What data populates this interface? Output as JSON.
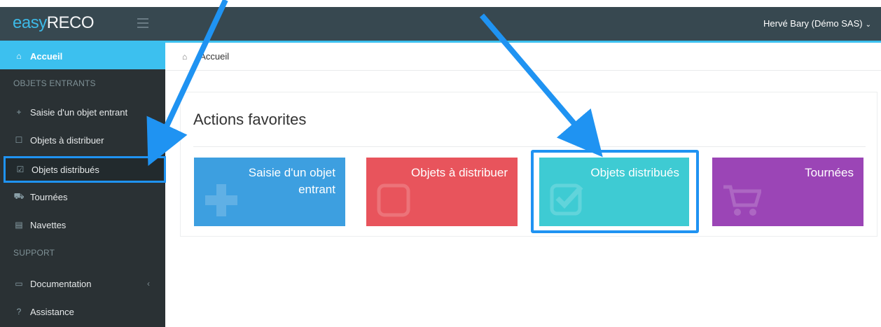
{
  "header": {
    "logo_prefix": "easy",
    "logo_suffix": "RECO",
    "user_name": "Hervé Bary (Démo SAS)",
    "user_chevron": "⌄"
  },
  "sidebar": {
    "items": [
      {
        "label": "Accueil",
        "icon": "home-icon",
        "glyph": "⌂"
      },
      {
        "label": "Saisie d'un objet entrant",
        "icon": "plus-icon",
        "glyph": "+"
      },
      {
        "label": "Objets à distribuer",
        "icon": "square-icon",
        "glyph": "☐"
      },
      {
        "label": "Objets distribués",
        "icon": "check-square-icon",
        "glyph": "☑"
      },
      {
        "label": "Tournées",
        "icon": "cart-icon",
        "glyph": "⛟"
      },
      {
        "label": "Navettes",
        "icon": "truck-icon",
        "glyph": "▤"
      },
      {
        "label": "Documentation",
        "icon": "book-icon",
        "glyph": "▭",
        "caret": "‹"
      },
      {
        "label": "Assistance",
        "icon": "help-icon",
        "glyph": "?"
      }
    ],
    "sections": [
      "OBJETS ENTRANTS",
      "SUPPORT"
    ]
  },
  "breadcrumb": {
    "home_glyph": "⌂",
    "current": "Accueil"
  },
  "panel": {
    "title": "Actions favorites",
    "tiles": [
      {
        "label_line1": "Saisie d'un objet",
        "label_line2": "entrant",
        "color": "#3d9fe0"
      },
      {
        "label_line1": "Objets à distribuer",
        "color": "#e8545c"
      },
      {
        "label_line1": "Objets distribués",
        "color": "#3ecbd3"
      },
      {
        "label_line1": "Tournées",
        "color": "#9b45b6"
      }
    ]
  },
  "colors": {
    "accent": "#3cc0ef",
    "highlight_arrow": "#1f93f2",
    "sidebar_bg": "#2a3134",
    "topbar_bg": "#374850"
  }
}
